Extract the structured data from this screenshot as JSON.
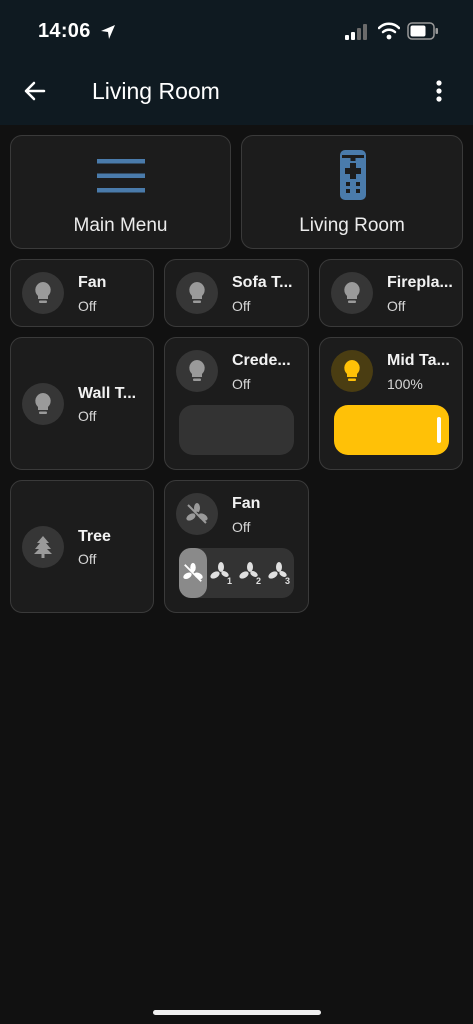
{
  "status_bar": {
    "time": "14:06"
  },
  "header": {
    "title": "Living Room"
  },
  "nav_cards": [
    {
      "label": "Main Menu",
      "icon": "menu-icon"
    },
    {
      "label": "Living Room",
      "icon": "remote-icon"
    }
  ],
  "tiles": {
    "fan": {
      "name": "Fan",
      "state": "Off"
    },
    "sofa": {
      "name": "Sofa T...",
      "state": "Off"
    },
    "fireplace": {
      "name": "Firepla...",
      "state": "Off"
    },
    "wall": {
      "name": "Wall T...",
      "state": "Off"
    },
    "credenza": {
      "name": "Crede...",
      "state": "Off",
      "brightness": 0
    },
    "mid": {
      "name": "Mid Ta...",
      "state": "100%",
      "brightness": 1.0
    },
    "tree": {
      "name": "Tree",
      "state": "Off"
    },
    "fan2": {
      "name": "Fan",
      "state": "Off",
      "speeds": [
        "off",
        "1",
        "2",
        "3"
      ],
      "selected_speed": "off"
    }
  },
  "colors": {
    "accent_on": "#ffc107",
    "header_bg": "#0f1a21",
    "page_bg": "#111111",
    "nav_icon": "#4a7bab"
  }
}
